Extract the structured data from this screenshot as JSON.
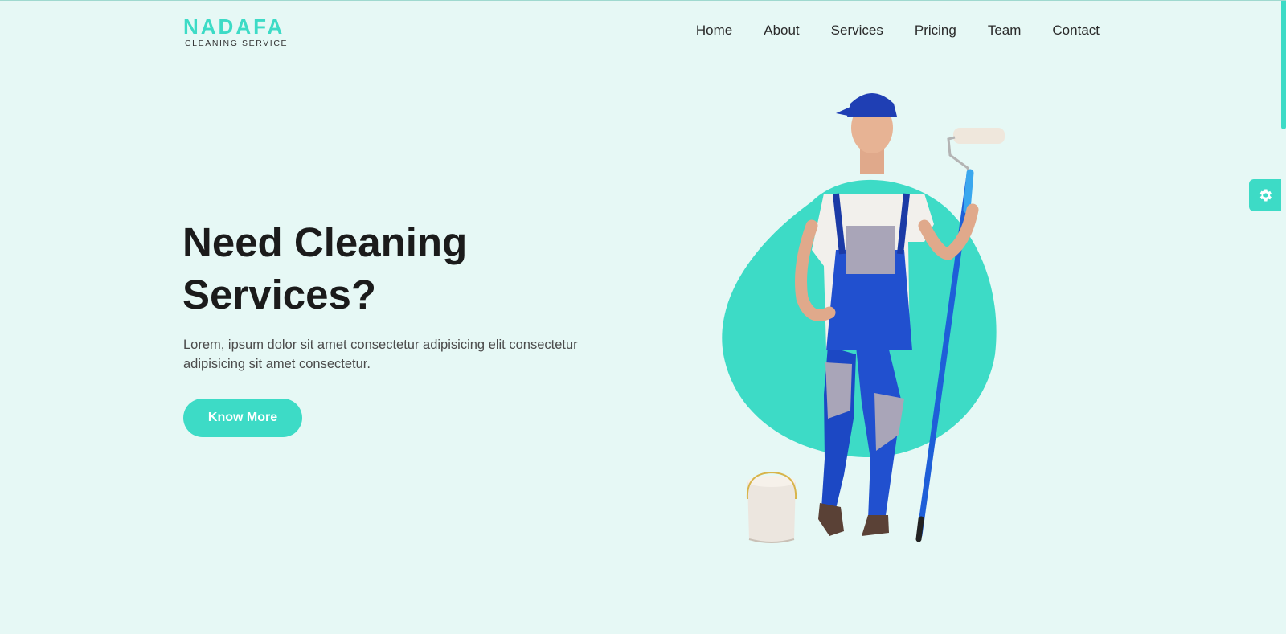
{
  "brand": {
    "name": "NADAFA",
    "tagline": "CLEANING SERVICE",
    "accent": "#3ddbc6"
  },
  "nav": {
    "items": [
      {
        "label": "Home"
      },
      {
        "label": "About"
      },
      {
        "label": "Services"
      },
      {
        "label": "Pricing"
      },
      {
        "label": "Team"
      },
      {
        "label": "Contact"
      }
    ]
  },
  "hero": {
    "title_line1": "Need Cleaning",
    "title_line2": "Services?",
    "text": "Lorem, ipsum dolor sit amet consectetur adipisicing elit consectetur adipisicing sit amet consectetur.",
    "button_label": "Know More",
    "illustration": "cleaning-worker-with-paint-roller"
  },
  "settings": {
    "icon": "gear-icon"
  }
}
